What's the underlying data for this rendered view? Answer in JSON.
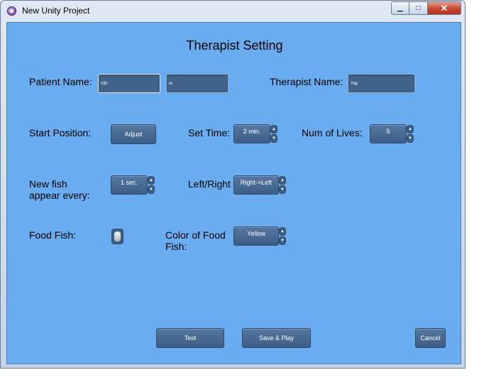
{
  "window": {
    "title": "New Unity Project"
  },
  "colors": {
    "background": "#69acf0",
    "control": "#41628a"
  },
  "page": {
    "title": "Therapist Setting"
  },
  "patient": {
    "label": "Patient Name:",
    "first_value": "n|in",
    "last_value": "er"
  },
  "therapist": {
    "label": "Therapist Name:",
    "value": "Yap"
  },
  "start_position": {
    "label": "Start Position:",
    "button": "Adjust"
  },
  "set_time": {
    "label": "Set Time:",
    "value": "2 min."
  },
  "lives": {
    "label": "Num of Lives:",
    "value": "5"
  },
  "fish_interval": {
    "label_line1": "New fish",
    "label_line2": "appear every:",
    "value": "1 sec."
  },
  "direction": {
    "label": "Left/Right",
    "value": "Right->Left"
  },
  "food_fish": {
    "label": "Food Fish:",
    "enabled": true
  },
  "food_color": {
    "label_line1": "Color of Food",
    "label_line2": "Fish:",
    "value": "Yellow"
  },
  "actions": {
    "test": "Test",
    "save_play": "Save & Play",
    "cancel": "Cancel"
  }
}
